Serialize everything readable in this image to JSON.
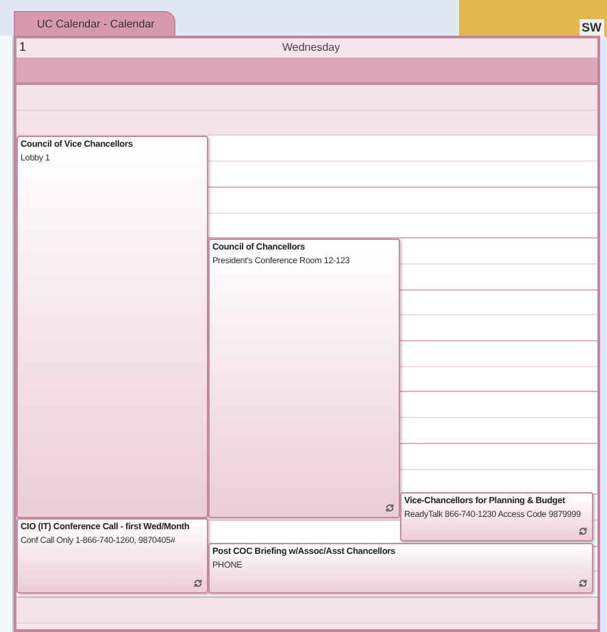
{
  "tab": {
    "title": "UC Calendar - Calendar",
    "selected": true
  },
  "background_window": {
    "text": "SW"
  },
  "day_header": {
    "date": "1",
    "weekday": "Wednesday"
  },
  "slots": [
    {
      "working": false
    },
    {
      "working": false
    },
    {
      "working": true
    },
    {
      "working": true
    },
    {
      "working": true
    },
    {
      "working": true
    },
    {
      "working": true
    },
    {
      "working": true
    },
    {
      "working": true
    },
    {
      "working": true
    },
    {
      "working": true
    },
    {
      "working": true
    },
    {
      "working": true
    },
    {
      "working": true
    },
    {
      "working": true
    },
    {
      "working": true
    },
    {
      "working": true
    },
    {
      "working": true
    },
    {
      "working": true
    },
    {
      "working": true
    },
    {
      "working": false
    },
    {
      "working": false
    }
  ],
  "events": [
    {
      "title": "Council of Vice Chancellors",
      "location": "Lobby 1",
      "recurring": false
    },
    {
      "title": "Council of Chancellors",
      "location": "President's Conference Room 12-123",
      "recurring": true
    },
    {
      "title": "Vice-Chancellors for Planning & Budget",
      "location": "ReadyTalk 866-740-1230 Access Code 9879999",
      "recurring": true
    },
    {
      "title": "CIO (IT) Conference Call - first Wed/Month",
      "location": "Conf Call Only 1-866-740-1260, 9870405#",
      "recurring": true
    },
    {
      "title": "Post COC Briefing w/Assoc/Asst Chancellors",
      "location": "PHONE",
      "recurring": true
    }
  ]
}
